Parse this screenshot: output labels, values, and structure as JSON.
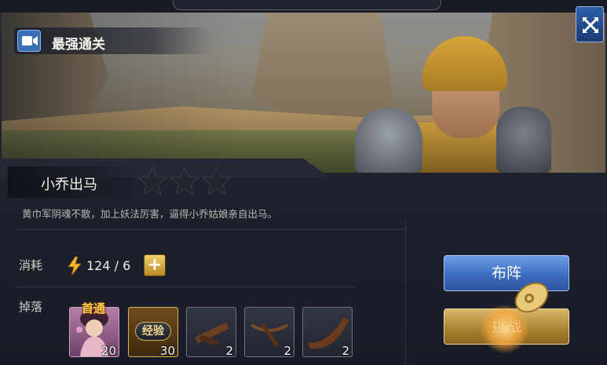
{
  "banner": {
    "clear_label": "最强通关",
    "camera_icon": "video-camera-icon",
    "close_icon": "expand-cross-icon"
  },
  "stage": {
    "title": "小乔出马",
    "stars_earned": 0,
    "stars_total": 3,
    "description": "黄巾军阴魂不散，加上妖法厉害，逼得小乔姑娘亲自出马。"
  },
  "cost": {
    "label": "消耗",
    "icon": "lightning-icon",
    "value": "124 / 6",
    "add_icon": "plus-icon"
  },
  "drops": {
    "label": "掉落",
    "first_clear_tag": "首通",
    "items": [
      {
        "name": "hero-portrait",
        "count": "20"
      },
      {
        "name": "experience",
        "badge": "经验",
        "count": "30"
      },
      {
        "name": "crossbow-part",
        "count": "2"
      },
      {
        "name": "crossbow",
        "count": "2"
      },
      {
        "name": "horn",
        "count": "2"
      }
    ]
  },
  "buttons": {
    "formation": "布阵",
    "challenge": "挑战"
  },
  "colors": {
    "formation_blue": "#3c6cc0",
    "challenge_gold": "#a8802f",
    "star_empty": "#23262e"
  }
}
